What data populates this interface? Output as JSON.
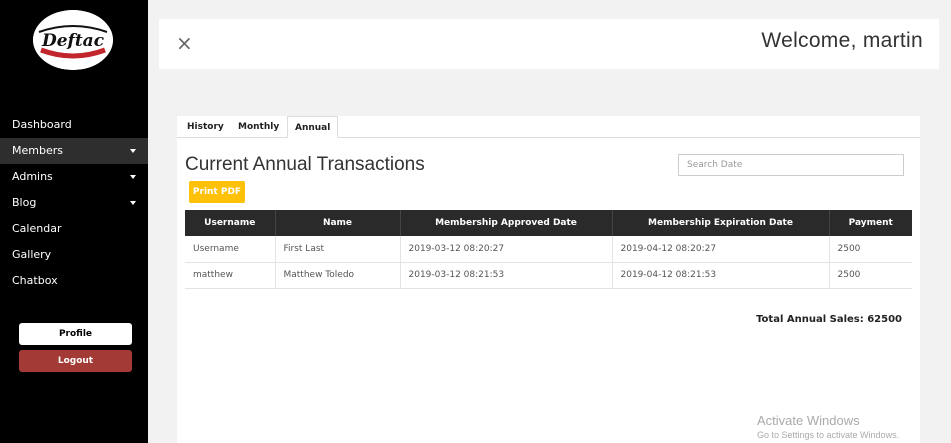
{
  "sidebar": {
    "logo_text": "Deftac",
    "items": [
      {
        "label": "Dashboard",
        "dropdown": false,
        "active": false
      },
      {
        "label": "Members",
        "dropdown": true,
        "active": true
      },
      {
        "label": "Admins",
        "dropdown": true,
        "active": false
      },
      {
        "label": "Blog",
        "dropdown": true,
        "active": false
      },
      {
        "label": "Calendar",
        "dropdown": false,
        "active": false
      },
      {
        "label": "Gallery",
        "dropdown": false,
        "active": false
      },
      {
        "label": "Chatbox",
        "dropdown": false,
        "active": false
      }
    ],
    "profile_label": "Profile",
    "logout_label": "Logout"
  },
  "header": {
    "close_icon": "×",
    "welcome": "Welcome, martin"
  },
  "tabs": [
    {
      "label": "History",
      "active": false
    },
    {
      "label": "Monthly",
      "active": false
    },
    {
      "label": "Annual",
      "active": true
    }
  ],
  "main": {
    "title": "Current Annual Transactions",
    "search_placeholder": "Search Date",
    "print_label": "Print PDF",
    "columns": [
      "Username",
      "Name",
      "Membership Approved Date",
      "Membership Expiration Date",
      "Payment"
    ],
    "rows": [
      [
        "Username",
        "First Last",
        "2019-03-12 08:20:27",
        "2019-04-12 08:20:27",
        "2500"
      ],
      [
        "matthew",
        "Matthew Toledo",
        "2019-03-12 08:21:53",
        "2019-04-12 08:21:53",
        "2500"
      ]
    ],
    "total": "Total Annual Sales: 62500"
  },
  "watermark": {
    "title": "Activate Windows",
    "subtitle": "Go to Settings to activate Windows."
  },
  "colors": {
    "sidebar_bg": "#000000",
    "logout_bg": "#a33a35",
    "print_bg": "#ffc107",
    "table_header_bg": "#2a2a2a"
  }
}
